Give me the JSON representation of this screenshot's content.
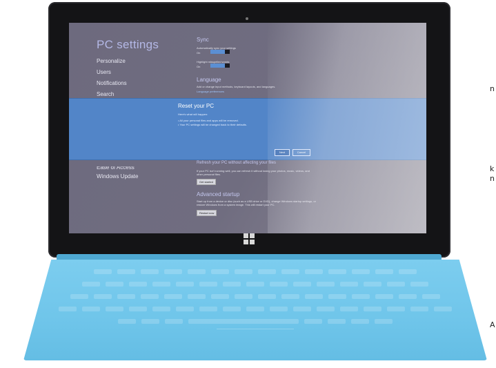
{
  "side_text": [
    "n",
    "k",
    "n",
    "A"
  ],
  "settings": {
    "app_title": "PC settings",
    "nav_top": [
      "Personalize",
      "Users",
      "Notifications",
      "Search"
    ],
    "nav_bottom": [
      "Ease of Access",
      "Windows Update"
    ]
  },
  "sync": {
    "title": "Sync",
    "toggle1_label": "Automatically sync your settings",
    "toggle1_state": "On",
    "toggle2_label": "Highlight misspelled words",
    "toggle2_state": "On"
  },
  "language": {
    "title": "Language",
    "desc": "Add or change input methods, keyboard layouts, and languages.",
    "link": "Language preferences"
  },
  "dialog": {
    "title": "Reset your PC",
    "subtitle": "Here's what will happen:",
    "bullet1": "• All your personal files and apps will be removed.",
    "bullet2": "• Your PC settings will be changed back to their defaults.",
    "next_label": "Next",
    "cancel_label": "Cancel"
  },
  "refresh": {
    "title": "Refresh your PC without affecting your files",
    "desc": "If your PC isn't running well, you can refresh it without losing your photos, music, videos, and other personal files.",
    "button": "Get started"
  },
  "advanced": {
    "title": "Advanced startup",
    "desc": "Start up from a device or disc (such as a USB drive or DVD), change Windows startup settings, or restore Windows from a system image. This will restart your PC.",
    "button": "Restart now"
  },
  "colors": {
    "bezel": "#141416",
    "screen_bg": "#6d6a7e",
    "dialog_bg": "#5285c8",
    "accent_text": "#b4b8e6",
    "cover": "#7ccdef"
  },
  "icons": [
    "windows-logo-icon",
    "camera-icon"
  ]
}
